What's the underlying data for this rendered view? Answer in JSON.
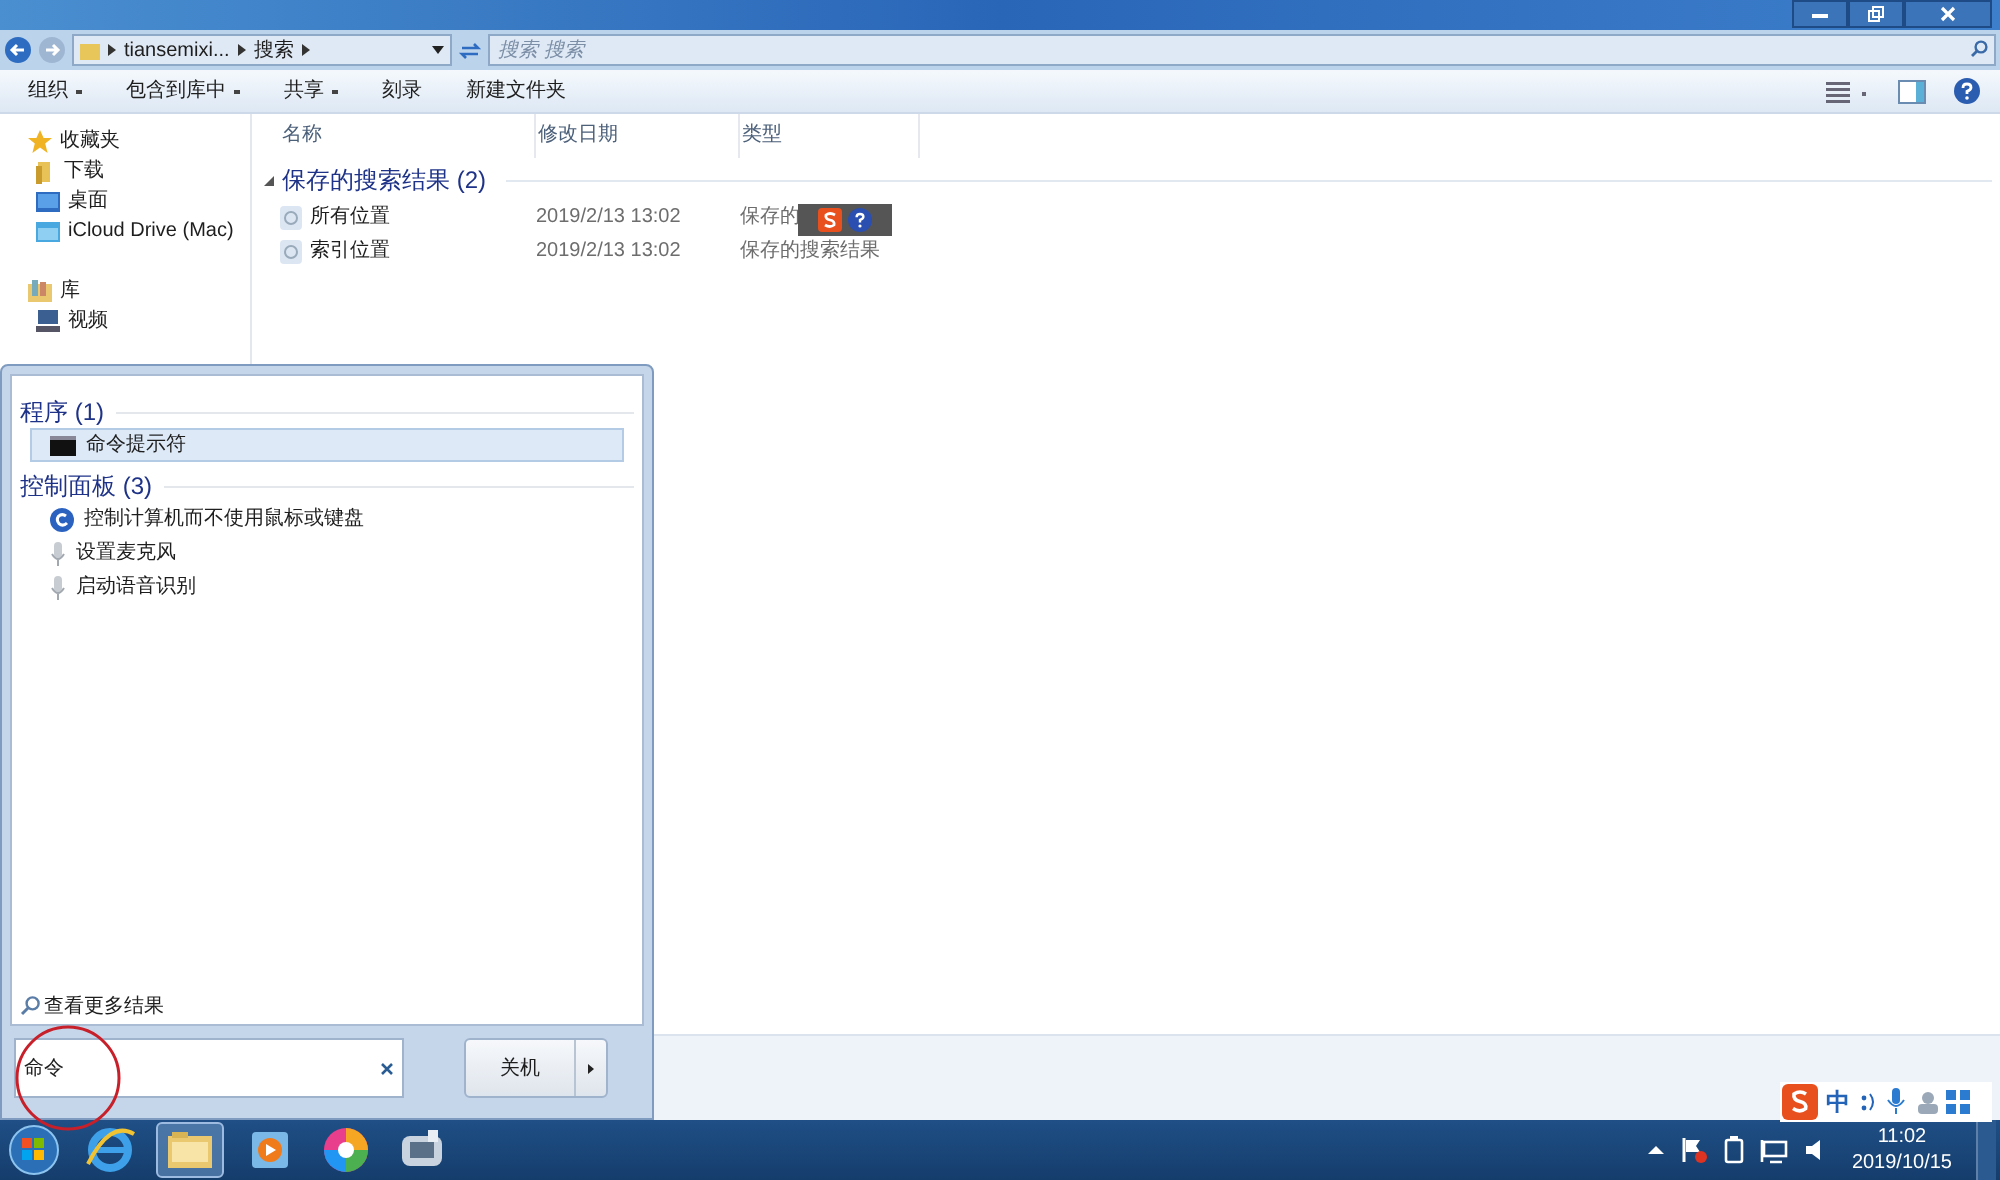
{
  "address_bar": {
    "path": [
      "tiansemixi...",
      "搜索"
    ],
    "search_placeholder": "搜索 搜索"
  },
  "toolbar": [
    {
      "label": "组织",
      "has_menu": true
    },
    {
      "label": "包含到库中",
      "has_menu": true
    },
    {
      "label": "共享",
      "has_menu": true
    },
    {
      "label": "刻录",
      "has_menu": false
    },
    {
      "label": "新建文件夹",
      "has_menu": false
    }
  ],
  "sidebar": {
    "items": [
      {
        "label": "收藏夹",
        "kind": "star",
        "children": [
          {
            "label": "下载",
            "kind": "folder"
          },
          {
            "label": "桌面",
            "kind": "desktop"
          },
          {
            "label": "iCloud Drive (Mac)",
            "kind": "cloud"
          }
        ]
      },
      {
        "label": "库",
        "kind": "library",
        "children": [
          {
            "label": "视频",
            "kind": "video"
          }
        ]
      }
    ]
  },
  "columns": [
    "名称",
    "修改日期",
    "类型"
  ],
  "groups": [
    {
      "title": "保存的搜索结果 (2)",
      "expanded": true,
      "rows": [
        {
          "name": "所有位置",
          "date": "2019/2/13 13:02",
          "type": "保存的"
        },
        {
          "name": "索引位置",
          "date": "2019/2/13 13:02",
          "type": "保存的搜索结果"
        }
      ]
    }
  ],
  "start_menu": {
    "sections": [
      {
        "title": "程序 (1)",
        "items": [
          {
            "label": "命令提示符",
            "kind": "console",
            "selected": true
          }
        ]
      },
      {
        "title": "控制面板 (3)",
        "items": [
          {
            "label": "控制计算机而不使用鼠标或键盘",
            "kind": "access",
            "selected": false
          },
          {
            "label": "设置麦克风",
            "kind": "mic",
            "selected": false
          },
          {
            "label": "启动语音识别",
            "kind": "mic",
            "selected": false
          }
        ]
      }
    ],
    "more_results": "查看更多结果",
    "search_value": "命令",
    "shutdown": "关机"
  },
  "ime_bar": {
    "mode": "中"
  },
  "clock": {
    "time": "11:02",
    "date": "2019/10/15"
  }
}
